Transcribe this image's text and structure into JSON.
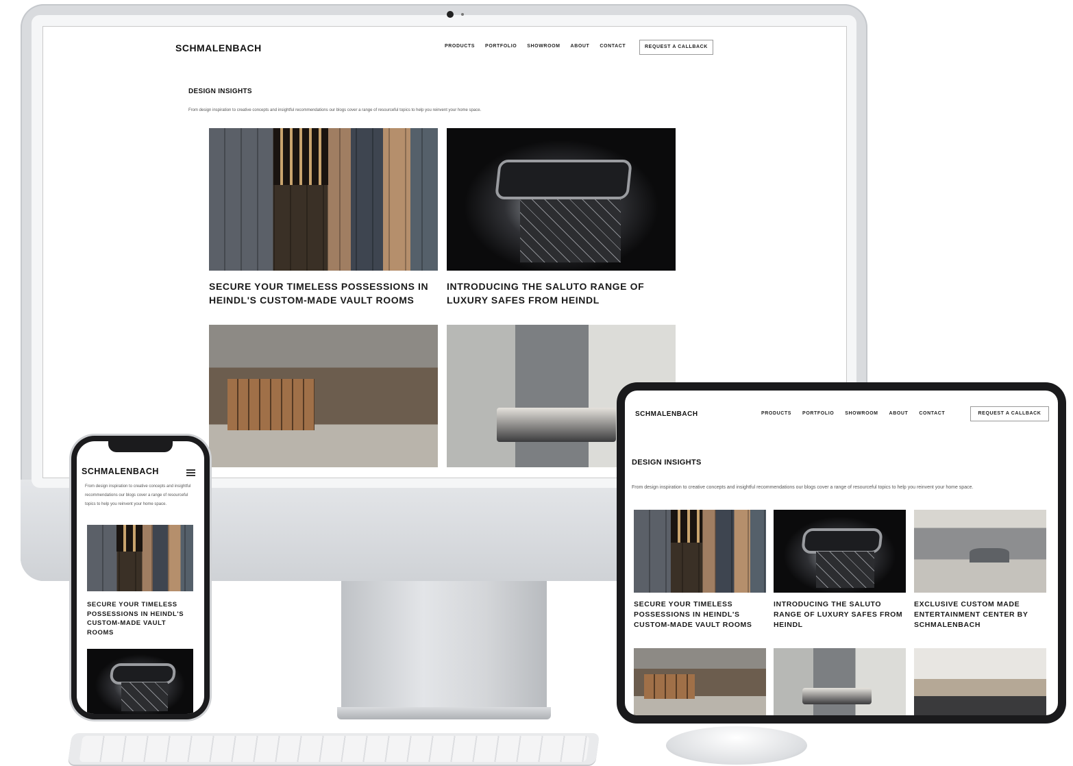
{
  "site": {
    "brand": "SCHMALENBACH",
    "nav": [
      "PRODUCTS",
      "PORTFOLIO",
      "SHOWROOM",
      "ABOUT",
      "CONTACT"
    ],
    "cta": "REQUEST A CALLBACK",
    "section_title": "DESIGN INSIGHTS",
    "intro": "From design inspiration to creative concepts and insightful recommendations our blogs cover a range of resourceful topics to help you reinvent your home space.",
    "cards": [
      {
        "title": "SECURE YOUR TIMELESS POSSESSIONS IN HEINDL'S CUSTOM-MADE VAULT ROOMS",
        "image": "vault-room"
      },
      {
        "title": "INTRODUCING THE SALUTO RANGE OF LUXURY SAFES FROM HEINDL",
        "image": "luxury-safe"
      },
      {
        "title": "EXCLUSIVE CUSTOM MADE ENTERTAINMENT CENTER BY SCHMALENBACH",
        "image": "entertainment-center"
      }
    ],
    "more_images": [
      "walk-in-closet",
      "bedroom",
      "living-room"
    ]
  },
  "icons": {
    "menu": "hamburger-menu-icon"
  },
  "colors": {
    "text": "#111111",
    "border": "#999999",
    "device_frame": "#1a1a1c"
  }
}
